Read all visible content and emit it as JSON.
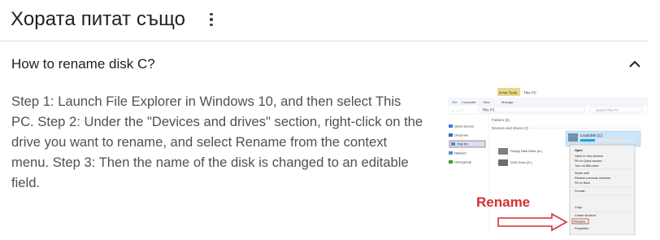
{
  "header": {
    "title": "Хората питат също",
    "more_icon": "more-vert-icon"
  },
  "question": {
    "text": "How to rename disk C?",
    "toggle_icon": "chevron-up-icon",
    "expanded": true
  },
  "answer": {
    "text": "Step 1: Launch File Explorer in Windows 10, and then select This PC. Step 2: Under the \"Devices and drives\" section, right-click on the drive you want to rename, and select Rename from the context menu. Step 3: Then the name of the disk is changed to an editable field."
  },
  "thumbnail": {
    "ribbon_tab_manage": "Drive Tools",
    "window_title": "This PC",
    "ribbon_tabs": [
      "File",
      "Computer",
      "View",
      "Manage"
    ],
    "address": "This PC",
    "search_placeholder": "Search This PC",
    "nav_items": [
      "Quick access",
      "OneDrive",
      "This PC",
      "Network",
      "Homegroup"
    ],
    "folders_header": "Folders (6)",
    "devices_header": "Devices and drives (4)",
    "drives": [
      "Local Disk (C:)",
      "Floppy Disk Drive (A:)",
      "DVD Drive (E:)"
    ],
    "context_menu": [
      "Open",
      "Open in new window",
      "Pin to Quick access",
      "Turn on BitLocker",
      "Share with",
      "Restore previous versions",
      "Pin to Start",
      "Format...",
      "Copy",
      "Create shortcut",
      "Rename",
      "Properties"
    ],
    "callout_label": "Rename",
    "callout_color": "#d32f2f"
  }
}
